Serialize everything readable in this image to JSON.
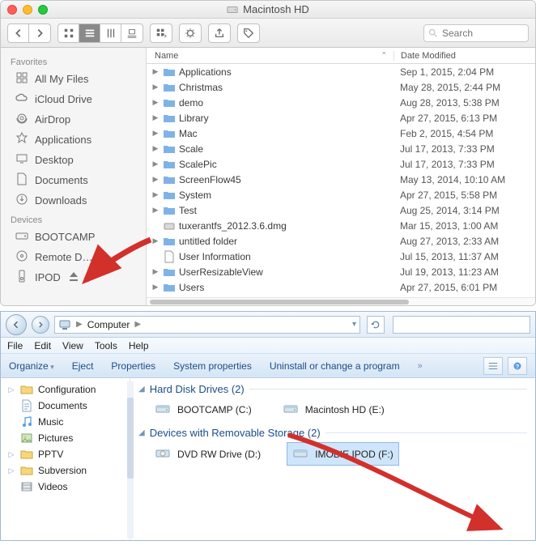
{
  "mac": {
    "title": "Macintosh HD",
    "search_placeholder": "Search",
    "sidebar": {
      "section_favorites": "Favorites",
      "section_devices": "Devices",
      "favorites": [
        {
          "label": "All My Files"
        },
        {
          "label": "iCloud Drive"
        },
        {
          "label": "AirDrop"
        },
        {
          "label": "Applications"
        },
        {
          "label": "Desktop"
        },
        {
          "label": "Documents"
        },
        {
          "label": "Downloads"
        }
      ],
      "devices": [
        {
          "label": "BOOTCAMP"
        },
        {
          "label": "Remote D…"
        },
        {
          "label": "IPOD",
          "ejectable": true
        }
      ]
    },
    "columns": {
      "name": "Name",
      "date": "Date Modified"
    },
    "files": [
      {
        "name": "Applications",
        "type": "folder",
        "date": "Sep 1, 2015, 2:04 PM"
      },
      {
        "name": "Christmas",
        "type": "folder",
        "date": "May 28, 2015, 2:44 PM"
      },
      {
        "name": "demo",
        "type": "folder",
        "date": "Aug 28, 2013, 5:38 PM"
      },
      {
        "name": "Library",
        "type": "folder",
        "date": "Apr 27, 2015, 6:13 PM"
      },
      {
        "name": "Mac",
        "type": "folder",
        "date": "Feb 2, 2015, 4:54 PM"
      },
      {
        "name": "Scale",
        "type": "folder",
        "date": "Jul 17, 2013, 7:33 PM"
      },
      {
        "name": "ScalePic",
        "type": "folder",
        "date": "Jul 17, 2013, 7:33 PM"
      },
      {
        "name": "ScreenFlow45",
        "type": "folder",
        "date": "May 13, 2014, 10:10 AM"
      },
      {
        "name": "System",
        "type": "folder",
        "date": "Apr 27, 2015, 5:58 PM"
      },
      {
        "name": "Test",
        "type": "folder",
        "date": "Aug 25, 2014, 3:14 PM"
      },
      {
        "name": "tuxerantfs_2012.3.6.dmg",
        "type": "dmg",
        "date": "Mar 15, 2013, 1:00 AM"
      },
      {
        "name": "untitled folder",
        "type": "folder",
        "date": "Aug 27, 2013, 2:33 AM"
      },
      {
        "name": "User Information",
        "type": "file",
        "date": "Jul 15, 2013, 11:37 AM"
      },
      {
        "name": "UserResizableView",
        "type": "folder",
        "date": "Jul 19, 2013, 11:23 AM"
      },
      {
        "name": "Users",
        "type": "folder",
        "date": "Apr 27, 2015, 6:01 PM"
      }
    ]
  },
  "win": {
    "breadcrumb": {
      "root": "Computer"
    },
    "menu": [
      "File",
      "Edit",
      "View",
      "Tools",
      "Help"
    ],
    "commands": {
      "organize": "Organize",
      "eject": "Eject",
      "properties": "Properties",
      "system_properties": "System properties",
      "uninstall": "Uninstall or change a program"
    },
    "sidebar": [
      {
        "label": "Configuration",
        "icon": "folder",
        "expandable": true
      },
      {
        "label": "Documents",
        "icon": "doc"
      },
      {
        "label": "Music",
        "icon": "music"
      },
      {
        "label": "Pictures",
        "icon": "pic"
      },
      {
        "label": "PPTV",
        "icon": "folder",
        "expandable": true
      },
      {
        "label": "Subversion",
        "icon": "folder",
        "expandable": true
      },
      {
        "label": "Videos",
        "icon": "video"
      }
    ],
    "groups": {
      "hdd": {
        "title": "Hard Disk Drives (2)",
        "items": [
          {
            "label": "BOOTCAMP (C:)",
            "icon": "localdisk"
          },
          {
            "label": "Macintosh HD (E:)",
            "icon": "localdisk"
          }
        ]
      },
      "removable": {
        "title": "Devices with Removable Storage (2)",
        "items": [
          {
            "label": "DVD RW Drive (D:)",
            "icon": "dvd"
          },
          {
            "label": "IMOBIE IPOD (F:)",
            "icon": "removable",
            "selected": true
          }
        ]
      }
    }
  }
}
